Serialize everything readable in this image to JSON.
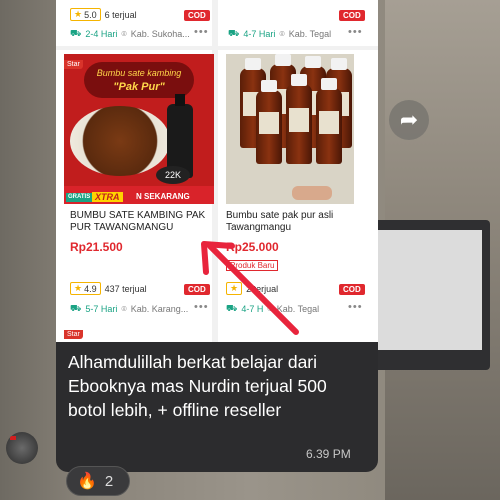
{
  "top_left": {
    "rating": "5.0",
    "sold": "6 terjual",
    "cod": "COD",
    "ship": "2-4 Hari",
    "location": "Kab. Sukoha...",
    "more": "•••"
  },
  "top_right": {
    "cod": "COD",
    "ship": "4-7 Hari",
    "location": "Kab. Tegal",
    "more": "•••"
  },
  "product1": {
    "tag": "Star",
    "banner_line1": "Bumbu sate kambing",
    "banner_line2": "\"Pak Pur\"",
    "weight": "22K",
    "gratis": "GRATIS ONGKIR",
    "xtra": "XTRA",
    "sekarang": "N SEKARANG",
    "title": "BUMBU SATE KAMBING PAK PUR TAWANGMANGU",
    "price": "Rp21.500",
    "rating": "4.9",
    "sold": "437 terjual",
    "cod": "COD",
    "ship": "5-7 Hari",
    "location": "Kab. Karang...",
    "more": "•••"
  },
  "product2": {
    "title": "Bumbu sate pak pur asli Tawangmangu",
    "price": "Rp25.000",
    "badge": "Produk Baru",
    "sold": "2 terjual",
    "cod": "COD",
    "ship": "4-7 H",
    "location": "Kab. Tegal",
    "more": "•••"
  },
  "bottom_tag": "Star",
  "message": {
    "text": "Alhamdulillah berkat belajar dari Ebooknya mas Nurdin terjual 500 botol lebih, + offline reseller",
    "time": "6.39 PM"
  },
  "reaction": {
    "emoji": "🔥",
    "count": "2"
  },
  "forward_icon": "share-arrow-icon",
  "colors": {
    "price_red": "#e0282e",
    "annotation_red": "#e8243c",
    "bubble": "#2c2c2e",
    "ship_green": "#1aa384"
  }
}
